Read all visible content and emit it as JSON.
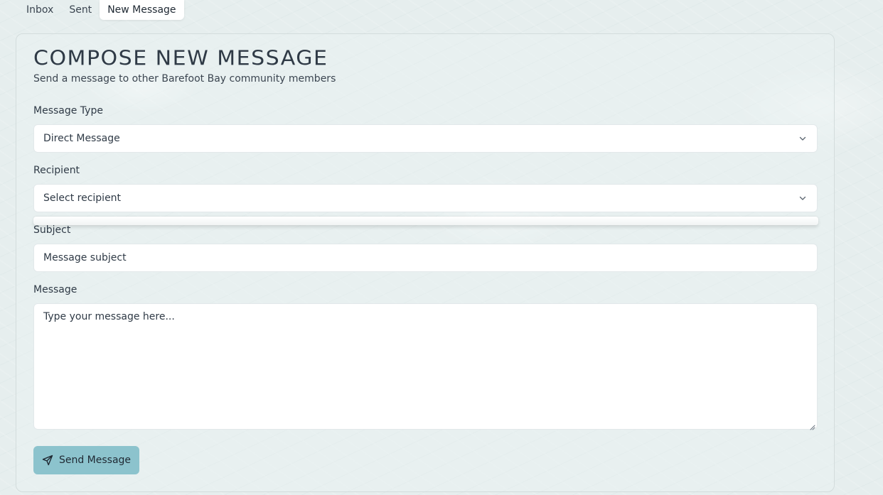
{
  "tabs": [
    {
      "label": "Inbox"
    },
    {
      "label": "Sent"
    },
    {
      "label": "New Message",
      "active": true
    }
  ],
  "compose": {
    "title": "COMPOSE NEW MESSAGE",
    "subtitle": "Send a message to other Barefoot Bay community members",
    "message_type": {
      "label": "Message Type",
      "value": "Direct Message"
    },
    "recipient": {
      "label": "Recipient",
      "value": "Select recipient"
    },
    "subject": {
      "label": "Subject",
      "placeholder": "Message subject"
    },
    "message": {
      "label": "Message",
      "placeholder": "Type your message here..."
    },
    "send_label": "Send Message"
  },
  "colors": {
    "button_bg": "#8cc3cd",
    "text": "#1f2933"
  },
  "icons": {
    "select_chevron": "chevron-down-icon",
    "send": "send-icon"
  }
}
